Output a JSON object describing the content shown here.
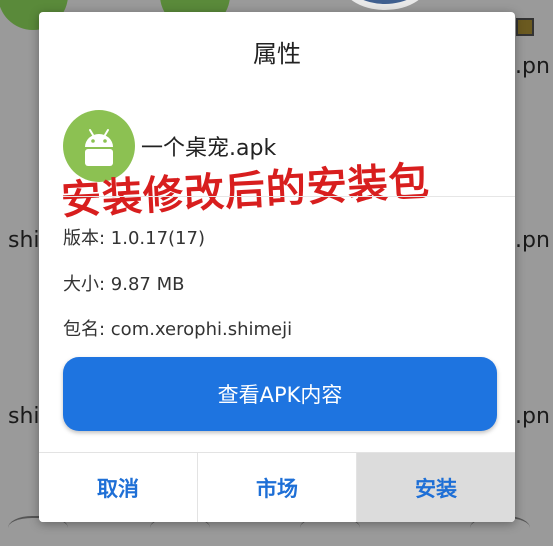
{
  "background": {
    "left_labels": [
      "shi",
      "shi"
    ],
    "right_labels": [
      ".pn",
      ".pn",
      ".pn"
    ]
  },
  "dialog": {
    "title": "属性",
    "apk_icon_label": "APK",
    "app_name": "一个桌宠.apk",
    "annotation": "安装修改后的安装包",
    "version": "版本: 1.0.17(17)",
    "size": "大小: 9.87 MB",
    "package": "包名: com.xerophi.shimeji",
    "view_button": "查看APK内容",
    "buttons": {
      "cancel": "取消",
      "market": "市场",
      "install": "安装"
    }
  },
  "colors": {
    "accent": "#1e74e0",
    "annotation": "#d81e1e",
    "android_green": "#8cc152"
  }
}
